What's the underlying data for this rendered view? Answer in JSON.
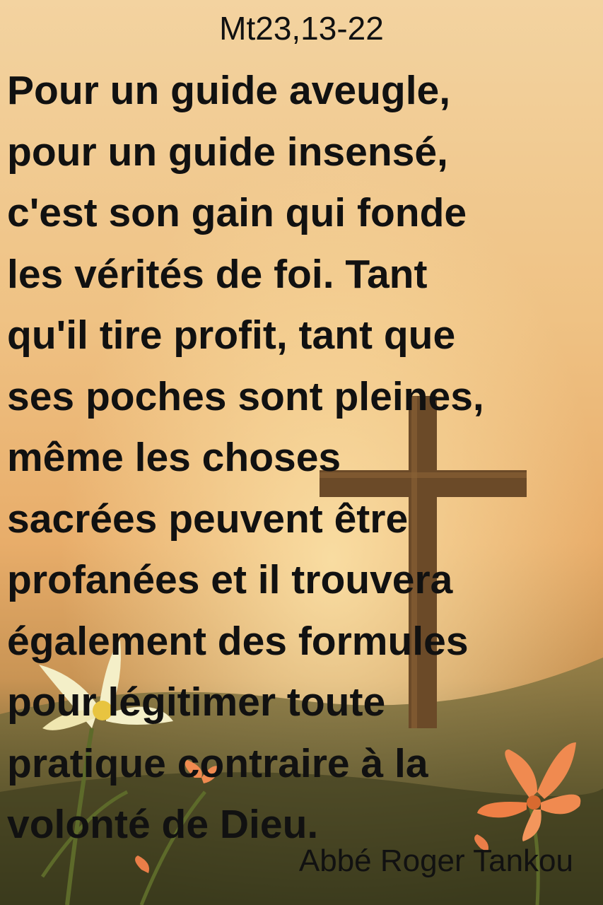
{
  "reference": "Mt23,13-22",
  "quote_lines": [
    "Pour un guide aveugle,",
    "pour un guide insensé,",
    "c'est son gain qui fonde",
    "les vérités de foi. Tant",
    "qu'il tire profit, tant que",
    "ses poches sont pleines,",
    "même les choses",
    "sacrées peuvent être",
    "profanées et il trouvera",
    "également des formules",
    "pour légitimer toute",
    "pratique contraire à la",
    "volonté de Dieu."
  ],
  "author": "Abbé Roger Tankou",
  "colors": {
    "sky_top": "#f2c98a",
    "sky_mid": "#eab070",
    "horizon": "#b98a4a",
    "meadow": "#4d4a25",
    "cross": "#6b4a28",
    "flower_orange": "#f08a50",
    "flower_white": "#f4efc8"
  },
  "icons": [
    "cross-icon",
    "lily-flower-icon",
    "orange-lily-flower-icon"
  ]
}
